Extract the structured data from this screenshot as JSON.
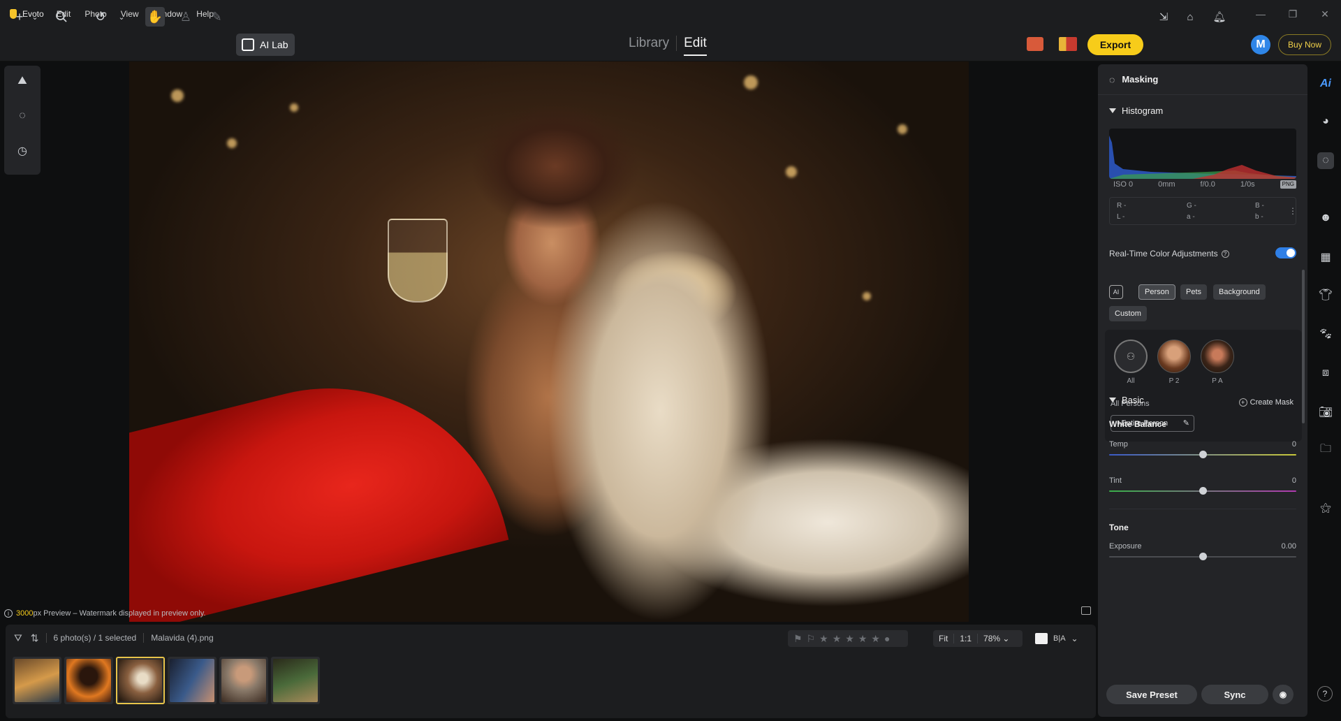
{
  "app": {
    "title": "Evoto",
    "menu": [
      "Edit",
      "Photo",
      "View",
      "Window",
      "Help"
    ]
  },
  "window_controls": {
    "minimize": "—",
    "restore": "❐",
    "close": "✕"
  },
  "toolbar": {
    "ai_lab": "AI Lab",
    "mode_library": "Library",
    "mode_edit": "Edit",
    "export": "Export",
    "buy_now": "Buy Now",
    "avatar_letter": "M"
  },
  "canvas": {
    "preview_note_bold": "3000",
    "preview_note_rest": "px Preview – Watermark displayed in preview only."
  },
  "filmstrip": {
    "count": "6 photo(s) / 1 selected",
    "filename": "Malavida (4).png",
    "zoom_fit": "Fit",
    "zoom_1to1": "1:1",
    "zoom_level": "78%",
    "thumbnails": [
      {
        "name": "thumb-1",
        "colors": [
          "#6a4a2a",
          "#2a3a4a"
        ]
      },
      {
        "name": "thumb-2",
        "colors": [
          "#e07820",
          "#3a1a10"
        ]
      },
      {
        "name": "thumb-3",
        "colors": [
          "#8a6040",
          "#1a120b"
        ],
        "selected": true
      },
      {
        "name": "thumb-4",
        "colors": [
          "#3a5a8a",
          "#1a2030"
        ]
      },
      {
        "name": "thumb-5",
        "colors": [
          "#8a7a6a",
          "#3a2a20"
        ]
      },
      {
        "name": "thumb-6",
        "colors": [
          "#4a6a3a",
          "#2a2a1a"
        ]
      }
    ]
  },
  "right_panel": {
    "title": "Masking",
    "histogram_label": "Histogram",
    "meta": {
      "iso": "ISO 0",
      "focal": "0mm",
      "aperture": "f/0.0",
      "shutter": "1/0s",
      "format": "PNG"
    },
    "rgb": {
      "r": "R -",
      "g": "G -",
      "b": "B -",
      "l": "L -",
      "a": "a -",
      "b2": "b -"
    },
    "realtime_label": "Real-Time Color Adjustments",
    "realtime_on": true,
    "chips": [
      "Person",
      "Pets",
      "Background",
      "Custom"
    ],
    "persons": [
      {
        "label": "All"
      },
      {
        "label": "P 2"
      },
      {
        "label": "P A"
      }
    ],
    "all_persons": "All Persons",
    "create_mask": "Create Mask",
    "entire_person": "+Entire Person",
    "basic": "Basic",
    "white_balance": "White Balance",
    "temp_label": "Temp",
    "temp_value": "0",
    "tint_label": "Tint",
    "tint_value": "0",
    "tone": "Tone",
    "exposure_label": "Exposure",
    "exposure_value": "0.00",
    "save_preset": "Save Preset",
    "sync": "Sync"
  },
  "colors": {
    "accent_yellow": "#f7cc1a",
    "toggle_blue": "#2f7fe6"
  }
}
